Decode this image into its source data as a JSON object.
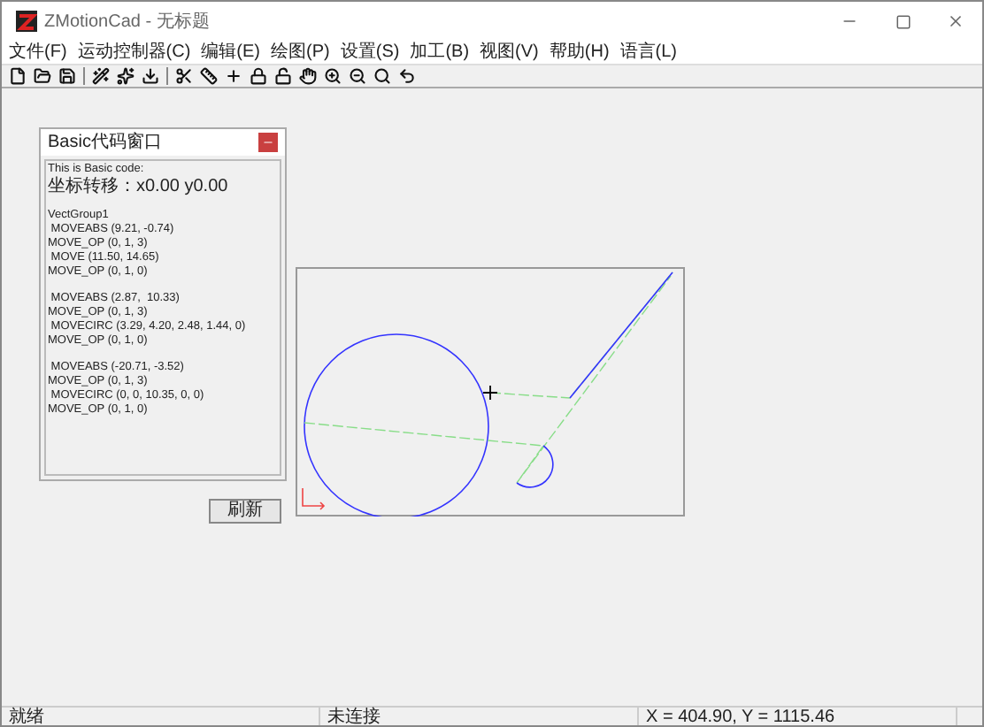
{
  "window": {
    "title": "ZMotionCad - 无标题"
  },
  "menu": [
    "文件(F)",
    "运动控制器(C)",
    "编辑(E)",
    "绘图(P)",
    "设置(S)",
    "加工(B)",
    "视图(V)",
    "帮助(H)",
    "语言(L)"
  ],
  "code_window": {
    "title": "Basic代码窗口",
    "blocks": [
      [
        "This is Basic code:",
        "坐标转移：x0.00 y0.00"
      ],
      [
        "VectGroup1",
        " MOVEABS (9.21, -0.74)",
        "MOVE_OP (0, 1, 3)",
        " MOVE (11.50, 14.65)",
        "MOVE_OP (0, 1, 0)"
      ],
      [
        " MOVEABS (2.87,  10.33)",
        "MOVE_OP (0, 1, 3)",
        " MOVECIRC (3.29, 4.20, 2.48, 1.44, 0)",
        "MOVE_OP (0, 1, 0)"
      ],
      [
        " MOVEABS (-20.71, -3.52)",
        "MOVE_OP (0, 1, 3)",
        " MOVECIRC (0, 0, 10.35, 0, 0)",
        "MOVE_OP (0, 1, 0)"
      ]
    ]
  },
  "refresh_button": "刷新",
  "status_bar": [
    "就绪",
    "未连接",
    "X = 404.90, Y = 1115.46"
  ]
}
